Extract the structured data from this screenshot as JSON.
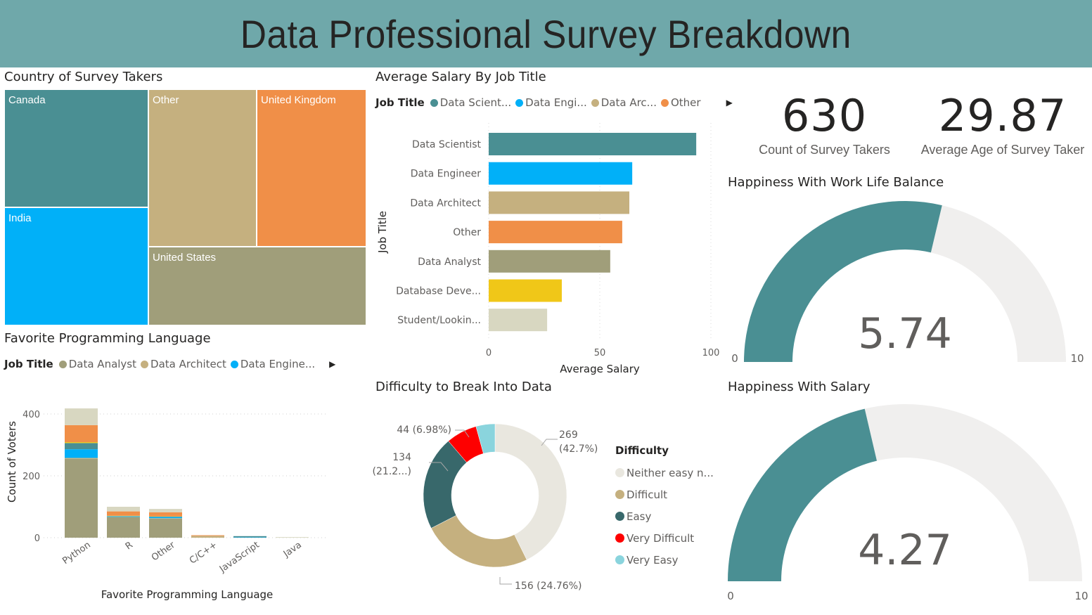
{
  "header": {
    "title": "Data Professional Survey Breakdown"
  },
  "colors": {
    "header_bg": "#6fa8aa",
    "teal": "#4a8f93",
    "blue": "#01b0f8",
    "tan": "#c5b07f",
    "orange": "#f08f48",
    "olive": "#a09e7a",
    "yellow": "#f0c718",
    "beige": "#d8d7c1",
    "dark_teal": "#38686b",
    "red": "#fe0000",
    "light_blue": "#8ad4dd",
    "light_gray": "#e9e7df",
    "gauge_track": "#f0efee"
  },
  "treemap": {
    "title": "Country of Survey Takers",
    "cells": [
      {
        "label": "Canada",
        "color": "#4a8f93"
      },
      {
        "label": "India",
        "color": "#01b0f8"
      },
      {
        "label": "Other",
        "color": "#c5b07f"
      },
      {
        "label": "United Kingdom",
        "color": "#f08f48"
      },
      {
        "label": "United States",
        "color": "#a09e7a"
      }
    ]
  },
  "salary_chart": {
    "title": "Average Salary By Job Title",
    "legend_title": "Job Title",
    "legend_items": [
      {
        "label": "Data Scient...",
        "color": "#4a8f93"
      },
      {
        "label": "Data Engi...",
        "color": "#01b0f8"
      },
      {
        "label": "Data Arc...",
        "color": "#c5b07f"
      },
      {
        "label": "Other",
        "color": "#f08f48"
      }
    ]
  },
  "language_chart": {
    "title": "Favorite Programming Language",
    "legend_title": "Job Title",
    "legend_items": [
      {
        "label": "Data Analyst",
        "color": "#a09e7a"
      },
      {
        "label": "Data Architect",
        "color": "#c5b07f"
      },
      {
        "label": "Data Engine...",
        "color": "#01b0f8"
      }
    ]
  },
  "difficulty_chart": {
    "title": "Difficulty to Break Into Data",
    "legend_title": "Difficulty",
    "legend_items": [
      {
        "label": "Neither easy n...",
        "color": "#e9e7df"
      },
      {
        "label": "Difficult",
        "color": "#c5b07f"
      },
      {
        "label": "Easy",
        "color": "#38686b"
      },
      {
        "label": "Very Difficult",
        "color": "#fe0000"
      },
      {
        "label": "Very Easy",
        "color": "#8ad4dd"
      }
    ]
  },
  "kpis": {
    "count": {
      "value": "630",
      "label": "Count of Survey Takers"
    },
    "age": {
      "value": "29.87",
      "label": "Average Age of Survey Taker"
    }
  },
  "gauges": {
    "work_life": {
      "title": "Happiness With Work Life Balance",
      "value_label": "5.74",
      "min_label": "0",
      "max_label": "10"
    },
    "salary": {
      "title": "Happiness With Salary",
      "value_label": "4.27",
      "min_label": "0",
      "max_label": "10"
    }
  },
  "chart_data": [
    {
      "id": "country_treemap",
      "type": "treemap",
      "title": "Country of Survey Takers",
      "categories": [
        "Canada",
        "India",
        "Other",
        "United Kingdom",
        "United States"
      ],
      "values_relative_estimate": [
        0.24,
        0.24,
        0.18,
        0.14,
        0.2
      ]
    },
    {
      "id": "salary_bar",
      "type": "bar",
      "orientation": "horizontal",
      "title": "Average Salary By Job Title",
      "xlabel": "Average Salary",
      "ylabel": "Job Title",
      "categories": [
        "Data Scientist",
        "Data Engineer",
        "Data Architect",
        "Other",
        "Data Analyst",
        "Database Deve...",
        "Student/Lookin..."
      ],
      "values": [
        93.4,
        64.6,
        63.3,
        60.1,
        54.7,
        32.9,
        26.3
      ],
      "colors": [
        "#4a8f93",
        "#01b0f8",
        "#c5b07f",
        "#f08f48",
        "#a09e7a",
        "#f0c718",
        "#d8d7c1"
      ],
      "xlim": [
        0,
        100
      ],
      "xticks": [
        "0",
        "50",
        "100"
      ],
      "grid": true,
      "legend": "top-left"
    },
    {
      "id": "language_stacked",
      "type": "bar",
      "stacked": true,
      "title": "Favorite Programming Language",
      "xlabel": "Favorite Programming Language",
      "ylabel": "Count of Voters",
      "categories": [
        "Python",
        "R",
        "Other",
        "C/C++",
        "JavaScript",
        "Java"
      ],
      "series": [
        {
          "name": "Data Analyst",
          "color": "#a09e7a",
          "values": [
            255,
            66,
            62,
            0,
            0,
            0
          ]
        },
        {
          "name": "Data Architect",
          "color": "#c5b07f",
          "values": [
            3,
            1,
            1,
            6,
            0,
            0
          ]
        },
        {
          "name": "Data Engineer",
          "color": "#01b0f8",
          "values": [
            28,
            2,
            4,
            0,
            1,
            0
          ]
        },
        {
          "name": "Data Scientist",
          "color": "#4a8f93",
          "values": [
            20,
            1,
            1,
            0,
            4,
            0
          ]
        },
        {
          "name": "Database Developer",
          "color": "#f0c718",
          "values": [
            3,
            1,
            1,
            0,
            0,
            0
          ]
        },
        {
          "name": "Other",
          "color": "#f08f48",
          "values": [
            55,
            14,
            13,
            2,
            0,
            0
          ]
        },
        {
          "name": "Student/Looking",
          "color": "#d8d7c1",
          "values": [
            54,
            15,
            11,
            0,
            0,
            2
          ]
        }
      ],
      "ylim": [
        0,
        420
      ],
      "yticks": [
        "0",
        "200",
        "400"
      ],
      "grid": true,
      "legend": "top-left"
    },
    {
      "id": "difficulty_donut",
      "type": "pie",
      "donut": true,
      "title": "Difficulty to Break Into Data",
      "categories": [
        "Neither easy nor difficult",
        "Difficult",
        "Easy",
        "Very Difficult",
        "Very Easy"
      ],
      "values": [
        269,
        156,
        134,
        44,
        27
      ],
      "data_labels": [
        {
          "line1": "269",
          "line2": "(42.7%)"
        },
        {
          "line1": "156 (24.76%)",
          "line2": ""
        },
        {
          "line1": "134",
          "line2": "(21.2...)"
        },
        {
          "line1": "44 (6.98%)",
          "line2": ""
        },
        {
          "line1": "",
          "line2": ""
        }
      ],
      "colors": [
        "#e9e7df",
        "#c5b07f",
        "#38686b",
        "#fe0000",
        "#8ad4dd"
      ],
      "legend": "right"
    },
    {
      "id": "gauge_work_life",
      "type": "gauge",
      "title": "Happiness With Work Life Balance",
      "value": 5.74,
      "min": 0,
      "max": 10
    },
    {
      "id": "gauge_salary",
      "type": "gauge",
      "title": "Happiness With Salary",
      "value": 4.27,
      "min": 0,
      "max": 10
    }
  ]
}
